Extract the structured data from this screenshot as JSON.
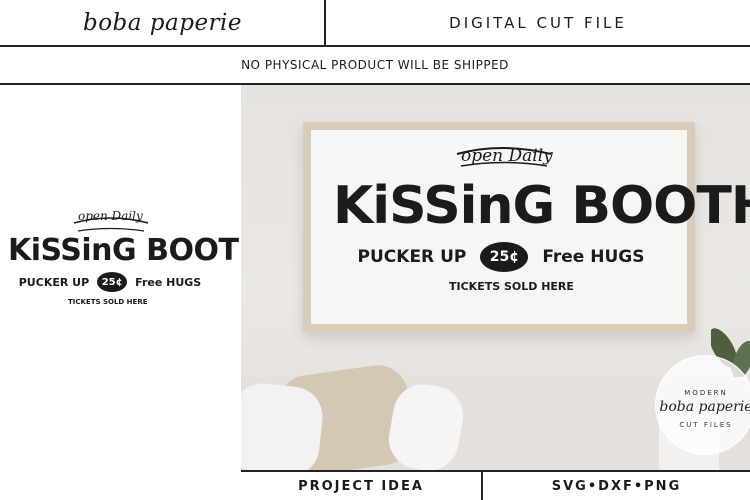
{
  "header": {
    "brand": "boba paperie",
    "doc_type": "DIGITAL CUT FILE"
  },
  "notice": "NO PHYSICAL PRODUCT  WILL BE SHIPPED",
  "design": {
    "open": "open Daily",
    "main": "KiSSinG BOOTH",
    "left_text": "PUCKER UP",
    "price": "25¢",
    "right_text": "Free HUGS",
    "tickets": "TICKETS SOLD HERE"
  },
  "logo": {
    "top": "MODERN",
    "mid": "boba paperie",
    "bottom": "CUT FILES"
  },
  "footer": {
    "left": "PROJECT IDEA",
    "right": "SVG•DXF•PNG"
  },
  "colors": {
    "ink": "#1b1b1b",
    "wall": "#e8e5e1",
    "frame": "#d9ccbb"
  }
}
